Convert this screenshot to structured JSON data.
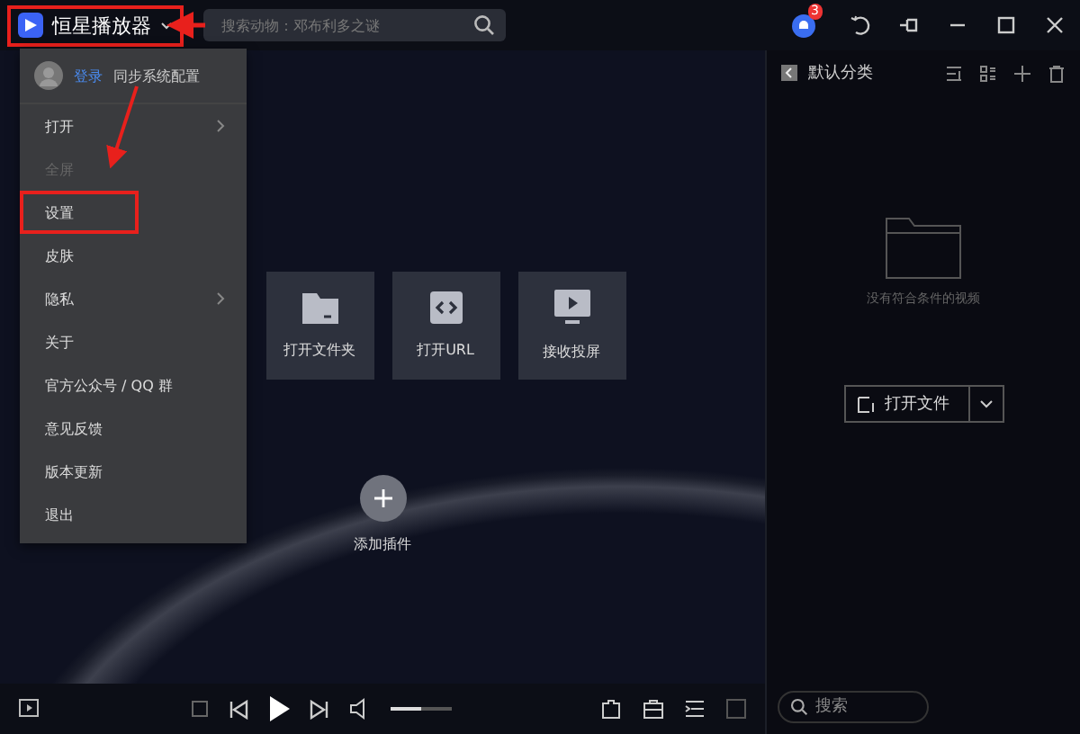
{
  "title": {
    "text": "恒星播放器",
    "highlighted": true
  },
  "search": {
    "placeholder": "搜索动物：邓布利多之谜"
  },
  "notification": {
    "count": "3"
  },
  "menu": {
    "login": "登录",
    "sync": "同步系统配置",
    "items": [
      {
        "label": "打开",
        "disabled": false,
        "submenu": true,
        "highlighted": false
      },
      {
        "label": "全屏",
        "disabled": true,
        "submenu": false,
        "highlighted": false
      },
      {
        "label": "设置",
        "disabled": false,
        "submenu": false,
        "highlighted": true
      },
      {
        "label": "皮肤",
        "disabled": false,
        "submenu": false,
        "highlighted": false
      },
      {
        "label": "隐私",
        "disabled": false,
        "submenu": true,
        "highlighted": false
      },
      {
        "label": "关于",
        "disabled": false,
        "submenu": false,
        "highlighted": false
      },
      {
        "label": "官方公众号 / QQ 群",
        "disabled": false,
        "submenu": false,
        "highlighted": false
      },
      {
        "label": "意见反馈",
        "disabled": false,
        "submenu": false,
        "highlighted": false
      },
      {
        "label": "版本更新",
        "disabled": false,
        "submenu": false,
        "highlighted": false
      },
      {
        "label": "退出",
        "disabled": false,
        "submenu": false,
        "highlighted": false
      }
    ]
  },
  "tiles": [
    {
      "label": "打开文件夹",
      "kind": "folder"
    },
    {
      "label": "打开URL",
      "kind": "link"
    },
    {
      "label": "接收投屏",
      "kind": "cast"
    }
  ],
  "plugin": {
    "label": "添加插件"
  },
  "panel": {
    "title": "默认分类",
    "empty_text": "没有符合条件的视频",
    "open_button": "打开文件",
    "search_placeholder": "搜索"
  },
  "player": {
    "volume": {
      "level": 0.5
    }
  }
}
